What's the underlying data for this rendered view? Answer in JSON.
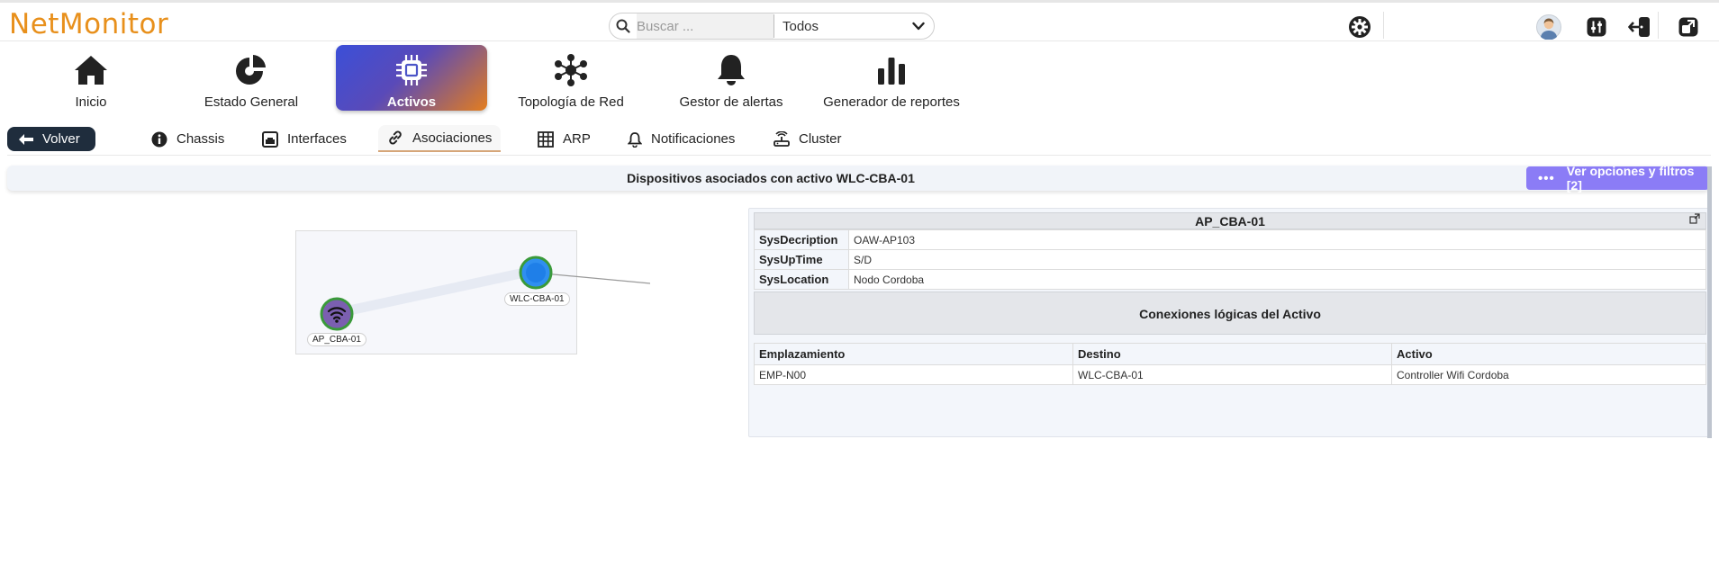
{
  "app": {
    "logo": "NetMonitor"
  },
  "search": {
    "placeholder": "Buscar ...",
    "scope": "Todos"
  },
  "nav": [
    {
      "label": "Inicio",
      "icon": "home-icon"
    },
    {
      "label": "Estado General",
      "icon": "pie-chart-icon"
    },
    {
      "label": "Activos",
      "icon": "chip-icon",
      "active": true
    },
    {
      "label": "Topología de Red",
      "icon": "network-topology-icon"
    },
    {
      "label": "Gestor de alertas",
      "icon": "bell-icon"
    },
    {
      "label": "Generador de reportes",
      "icon": "bar-chart-icon"
    }
  ],
  "subnav": {
    "back": "Volver",
    "tabs": [
      {
        "label": "Chassis",
        "icon": "info-icon"
      },
      {
        "label": "Interfaces",
        "icon": "interfaces-icon"
      },
      {
        "label": "Asociaciones",
        "icon": "link-icon",
        "active": true
      },
      {
        "label": "ARP",
        "icon": "table-icon"
      },
      {
        "label": "Notificaciones",
        "icon": "bell-icon"
      },
      {
        "label": "Cluster",
        "icon": "cluster-icon"
      }
    ]
  },
  "titlebar": {
    "text": "Dispositivos asociados con activo WLC-CBA-01",
    "options_button": "Ver opciones y filtros [2]"
  },
  "graph": {
    "nodes": [
      {
        "label": "AP_CBA-01",
        "icon": "wifi-icon"
      },
      {
        "label": "WLC-CBA-01",
        "icon": "controller-node-icon"
      }
    ]
  },
  "detail": {
    "title": "AP_CBA-01",
    "info": [
      {
        "key": "SysDecription",
        "value": "OAW-AP103"
      },
      {
        "key": "SysUpTime",
        "value": "S/D"
      },
      {
        "key": "SysLocation",
        "value": "Nodo Cordoba"
      }
    ],
    "connections_title": "Conexiones lógicas del Activo",
    "columns": [
      "Emplazamiento",
      "Destino",
      "Activo"
    ],
    "rows": [
      [
        "EMP-N00",
        "WLC-CBA-01",
        "Controller Wifi Cordoba"
      ]
    ]
  },
  "colors": {
    "brand": "#e8901c",
    "accent": "#8b7cf6",
    "dark": "#1f2d3d"
  }
}
